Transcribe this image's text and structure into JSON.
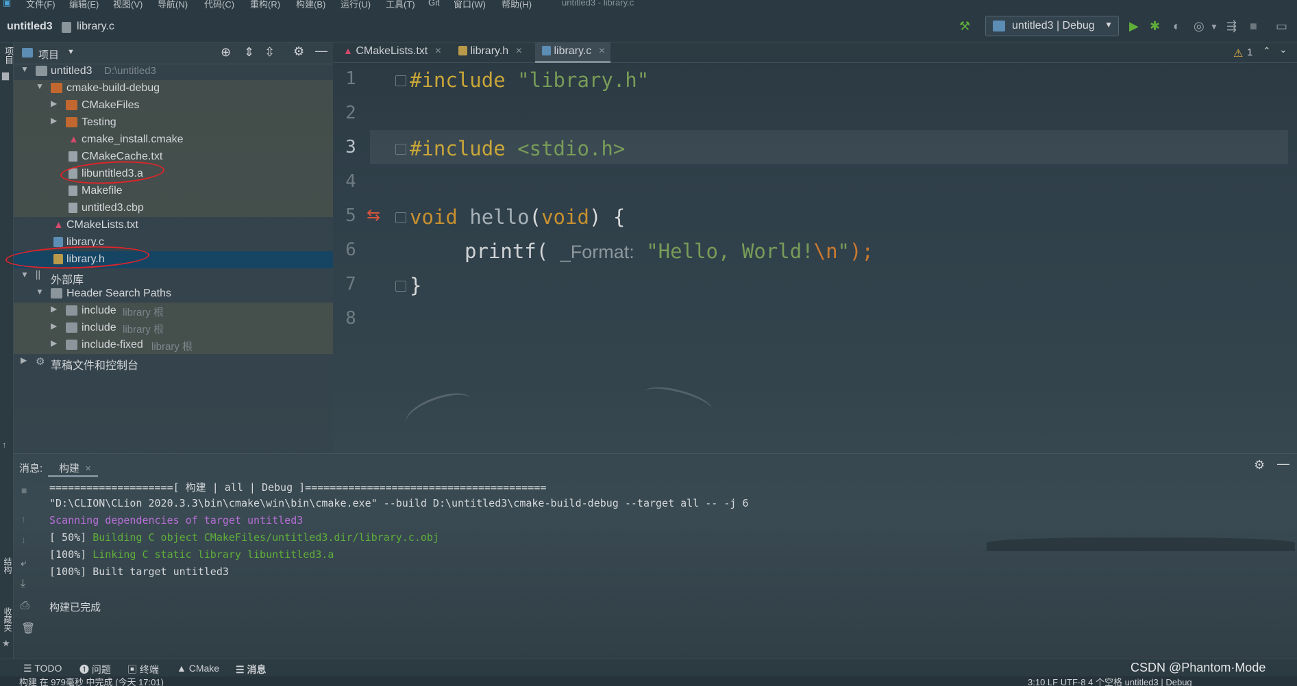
{
  "menubar": {
    "items": [
      "文件(F)",
      "编辑(E)",
      "视图(V)",
      "导航(N)",
      "代码(C)",
      "重构(R)",
      "构建(B)",
      "运行(U)",
      "工具(T)",
      "Git",
      "窗口(W)",
      "帮助(H)"
    ],
    "window_title": "untitled3 - library.c"
  },
  "navbar": {
    "project": "untitled3",
    "file": "library.c",
    "run_config": "untitled3 | Debug"
  },
  "project_panel": {
    "title": "项目",
    "side_label": "项目",
    "rows": [
      {
        "label": "untitled3",
        "extra": "D:\\untitled3"
      },
      {
        "label": "cmake-build-debug"
      },
      {
        "label": "CMakeFiles"
      },
      {
        "label": "Testing"
      },
      {
        "label": "cmake_install.cmake"
      },
      {
        "label": "CMakeCache.txt"
      },
      {
        "label": "libuntitled3.a"
      },
      {
        "label": "Makefile"
      },
      {
        "label": "untitled3.cbp"
      },
      {
        "label": "CMakeLists.txt"
      },
      {
        "label": "library.c"
      },
      {
        "label": "library.h"
      },
      {
        "label": "外部库"
      },
      {
        "label": "Header Search Paths"
      },
      {
        "label": "include",
        "extra": "library 根"
      },
      {
        "label": "include",
        "extra": "library 根"
      },
      {
        "label": "include-fixed",
        "extra": "library 根"
      },
      {
        "label": "草稿文件和控制台"
      }
    ]
  },
  "editor": {
    "tabs": [
      {
        "label": "CMakeLists.txt"
      },
      {
        "label": "library.h"
      },
      {
        "label": "library.c"
      }
    ],
    "warnings": "1",
    "line_numbers": [
      "1",
      "2",
      "3",
      "4",
      "5",
      "6",
      "7",
      "8"
    ],
    "lines": {
      "l1_kw": "#include",
      "l1_str": "\"library.h\"",
      "l3_kw": "#include",
      "l3_str": "<stdio.h>",
      "l5_ty": "void",
      "l5_fn": "hello",
      "l5_p1": "(",
      "l5_ty2": "void",
      "l5_p2": ") {",
      "l6_fn": "printf(",
      "l6_hint": "_Format:",
      "l6_str": "\"Hello, World!",
      "l6_esc": "\\n",
      "l6_str2": "\"",
      "l6_end": ");",
      "l7": "}"
    }
  },
  "messages": {
    "label": "消息:",
    "tab": "构建",
    "console": [
      "====================[ 构建 | all | Debug ]=======================================",
      "\"D:\\CLION\\CLion 2020.3.3\\bin\\cmake\\win\\bin\\cmake.exe\" --build D:\\untitled3\\cmake-build-debug --target all -- -j 6",
      "Scanning dependencies of target untitled3",
      "[ 50%] ",
      "Building C object CMakeFiles/untitled3.dir/library.c.obj",
      "[100%] ",
      "Linking C static library libuntitled3.a",
      "[100%] Built target untitled3",
      "构建已完成"
    ]
  },
  "left_strip": {
    "structure": "结构",
    "favorites": "收藏夹"
  },
  "bottom_tabs": [
    "TODO",
    "问题",
    "终端",
    "CMake",
    "消息"
  ],
  "watermark": "CSDN @Phantom·Mode",
  "status": {
    "left": "构建 在 979毫秒 中完成 (今天 17:01)",
    "right": "3:10   LF   UTF-8   4 个空格   untitled3 | Debug"
  },
  "colors": {
    "accent_green": "#5fae3a",
    "keyword": "#c9a638",
    "string": "#789c58",
    "selection": "#164564",
    "highlight_circle": "#e0242a"
  }
}
